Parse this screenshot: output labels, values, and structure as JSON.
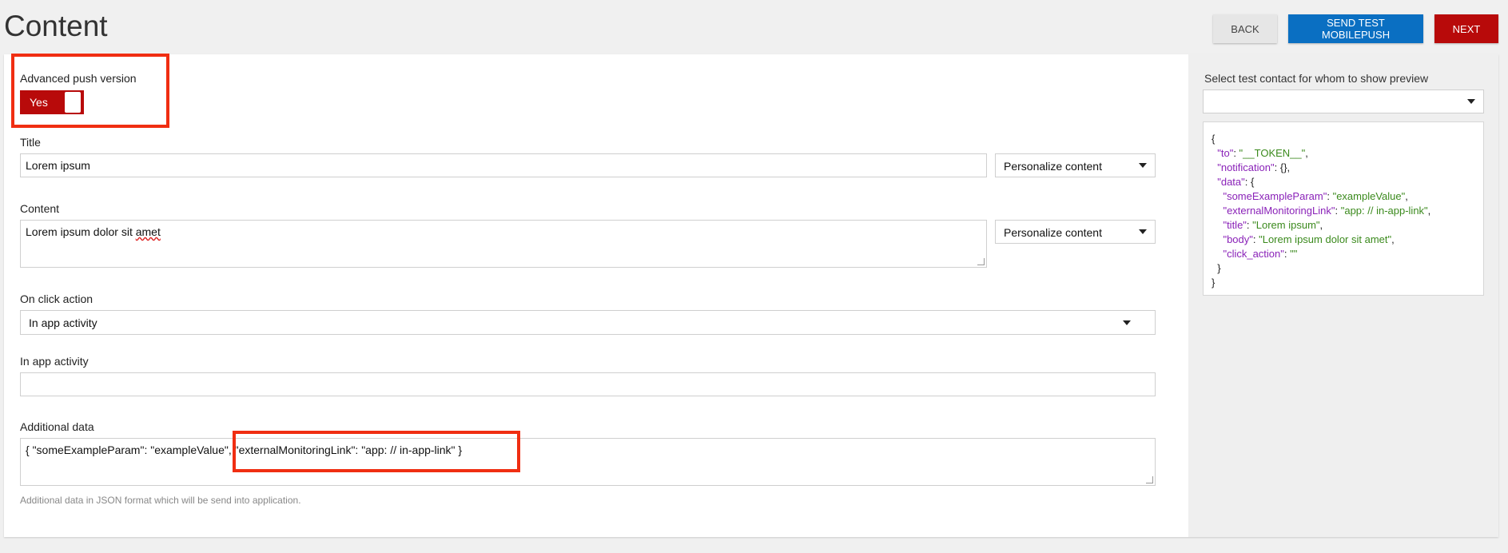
{
  "header": {
    "title": "Content",
    "back_label": "BACK",
    "send_test_label": "SEND TEST MOBILEPUSH",
    "next_label": "NEXT"
  },
  "form": {
    "advanced_label": "Advanced push version",
    "advanced_toggle": "Yes",
    "title_label": "Title",
    "title_value": "Lorem ipsum",
    "title_personalize": "Personalize content",
    "content_label": "Content",
    "content_value_a": "Lorem ipsum dolor sit ",
    "content_value_b": "amet",
    "content_personalize": "Personalize content",
    "onclick_label": "On click action",
    "onclick_value": "In app activity",
    "inapp_label": "In app activity",
    "inapp_value": "",
    "additional_label": "Additional data",
    "additional_value": "{ \"someExampleParam\": \"exampleValue\", \"externalMonitoringLink\": \"app: // in-app-link\" }",
    "additional_hint": "Additional data in JSON format which will be send into application."
  },
  "preview": {
    "label": "Select test contact for whom to show preview",
    "contact_value": "",
    "json": {
      "open": "{",
      "to_key": "\"to\"",
      "to_val": "\"__TOKEN__\"",
      "notification_key": "\"notification\"",
      "notification_val": "{}",
      "data_key": "\"data\"",
      "p1_key": "\"someExampleParam\"",
      "p1_val": "\"exampleValue\"",
      "p2_key": "\"externalMonitoringLink\"",
      "p2_val": "\"app: // in-app-link\"",
      "p3_key": "\"title\"",
      "p3_val": "\"Lorem ipsum\"",
      "p4_key": "\"body\"",
      "p4_val": "\"Lorem ipsum dolor sit amet\"",
      "p5_key": "\"click_action\"",
      "p5_val": "\"\"",
      "inner_close": "}",
      "close": "}"
    }
  },
  "colors": {
    "primary_red": "#b80a0a",
    "primary_blue": "#0a6fc2",
    "highlight": "#f02e12",
    "json_key": "#8a22b8",
    "json_value": "#3b8a1d"
  }
}
